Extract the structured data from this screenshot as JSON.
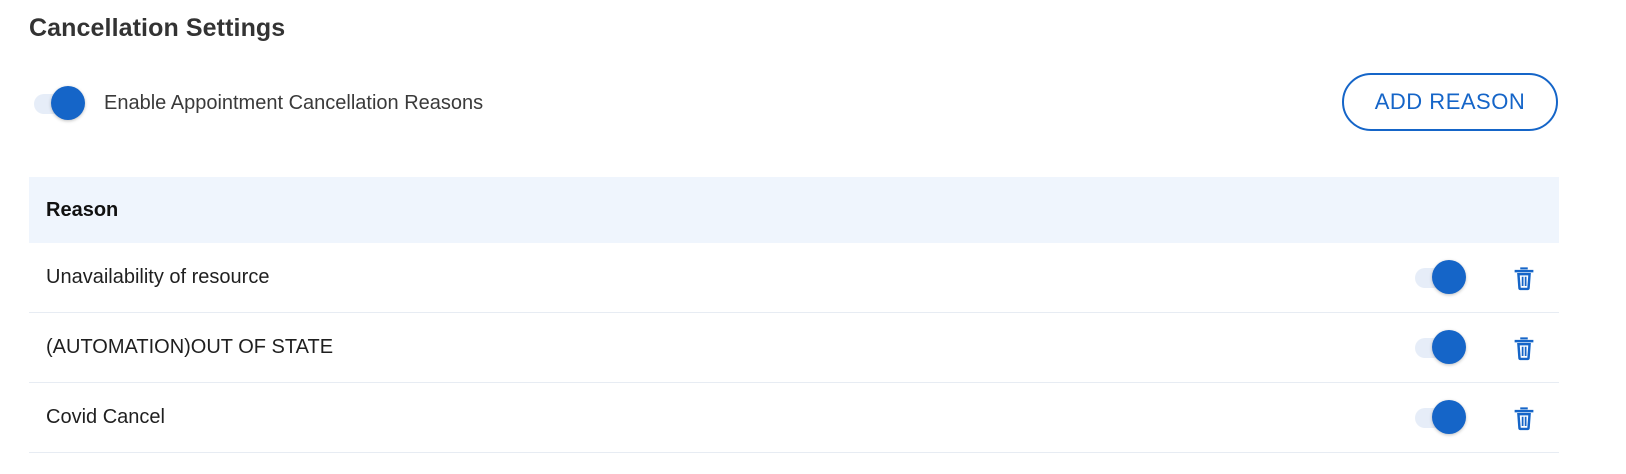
{
  "page": {
    "title": "Cancellation Settings"
  },
  "enable_toggle": {
    "label": "Enable Appointment Cancellation Reasons",
    "checked": true
  },
  "add_button": {
    "label": "ADD REASON"
  },
  "table": {
    "columns": [
      "Reason"
    ],
    "rows": [
      {
        "reason": "Unavailability of resource",
        "enabled": true,
        "delete_icon": "trash-icon"
      },
      {
        "reason": "(AUTOMATION)OUT OF STATE",
        "enabled": true,
        "delete_icon": "trash-icon"
      },
      {
        "reason": "Covid Cancel",
        "enabled": true,
        "delete_icon": "trash-icon"
      }
    ]
  },
  "colors": {
    "accent": "#1565c8",
    "toggle_track": "#e6edf8",
    "header_bg": "#eff5fd"
  }
}
